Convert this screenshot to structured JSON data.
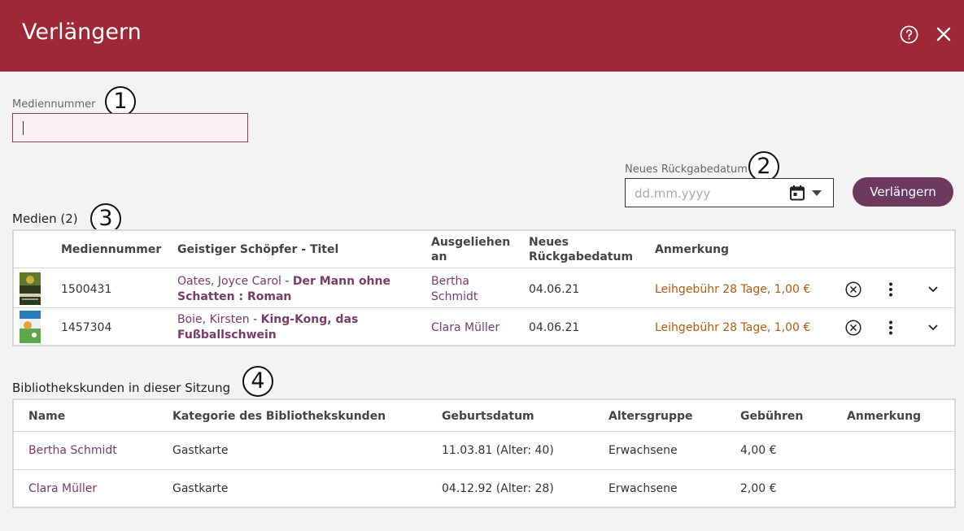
{
  "header": {
    "title": "Verlängern"
  },
  "icons": {
    "help": "help-circle-icon",
    "close": "close-icon",
    "calendar": "calendar-icon",
    "remove": "remove-circle-icon",
    "more": "more-vertical-icon",
    "expand": "chevron-down-icon"
  },
  "colors": {
    "header": "#9e2835",
    "accent": "#6c3a5f",
    "link": "#7a3b6b",
    "note": "#b35a0b"
  },
  "medium_field": {
    "label": "Mediennummer",
    "value": ""
  },
  "due_date": {
    "label": "Neues Rückgabedatum",
    "placeholder": "dd.mm.yyyy"
  },
  "extend_button": {
    "label": "Verlängern"
  },
  "callouts": [
    "1",
    "2",
    "3",
    "4"
  ],
  "media": {
    "title": "Medien (2)",
    "columns": {
      "number": "Mediennummer",
      "title": "Geistiger Schöpfer - Titel",
      "borrowed_line1": "Ausgeliehen",
      "borrowed_line2": "an",
      "due_line1": "Neues",
      "due_line2": "Rückgabedatum",
      "note": "Anmerkung"
    },
    "rows": [
      {
        "number": "1500431",
        "author": "Oates, Joyce Carol",
        "sep": " - ",
        "title_line1": "Der Mann ohne",
        "title_line2": "Schatten : Roman",
        "borrower_line1": "Bertha",
        "borrower_line2": "Schmidt",
        "due": "04.06.21",
        "note": "Leihgebühr 28 Tage, 1,00 €"
      },
      {
        "number": "1457304",
        "author": "Boie, Kirsten",
        "sep": " - ",
        "title_line1": "King-Kong, das",
        "title_line2": "Fußballschwein",
        "borrower_line1": "Clara Müller",
        "borrower_line2": "",
        "due": "04.06.21",
        "note": "Leihgebühr 28 Tage, 1,00 €"
      }
    ]
  },
  "patrons": {
    "title": "Bibliothekskunden in dieser Sitzung",
    "columns": {
      "name": "Name",
      "category": "Kategorie des Bibliothekskunden",
      "birth": "Geburtsdatum",
      "age_group": "Altersgruppe",
      "fees": "Gebühren",
      "note": "Anmerkung"
    },
    "rows": [
      {
        "name": "Bertha Schmidt",
        "category": "Gastkarte",
        "birth": "11.03.81 (Alter: 40)",
        "age_group": "Erwachsene",
        "fees": "4,00 €",
        "note": ""
      },
      {
        "name": "Clara Müller",
        "category": "Gastkarte",
        "birth": "04.12.92 (Alter: 28)",
        "age_group": "Erwachsene",
        "fees": "2,00 €",
        "note": ""
      }
    ]
  }
}
